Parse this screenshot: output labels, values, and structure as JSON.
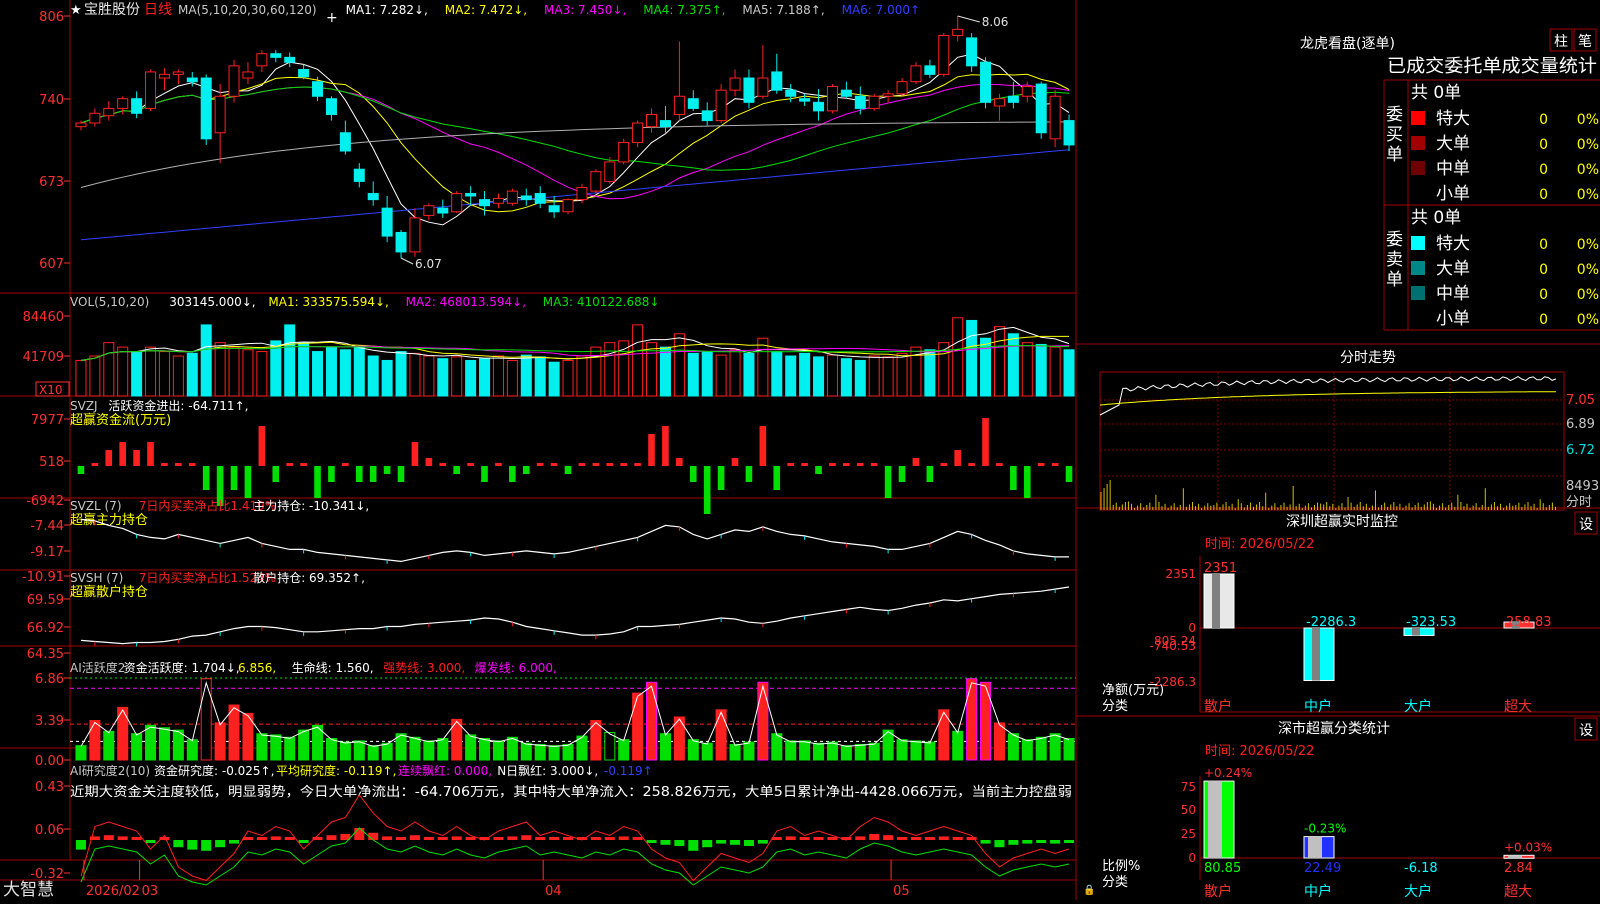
{
  "stock": {
    "star": "★",
    "name": "宝胜股份",
    "period": "日线"
  },
  "colors": {
    "up": "#ff2020",
    "down": "#00f0f0",
    "frame": "#a00000",
    "green": "#00e000",
    "yellow": "#ffff00",
    "magenta": "#ff00ff",
    "white": "#ffffff",
    "blue": "#3040ff",
    "gray": "#b0b0b0",
    "label": "#e0e0e0"
  },
  "main": {
    "header": [
      {
        "text": "MA(5,10,20,30,60,120)",
        "color": "#c8c8c8"
      },
      {
        "text": "MA1: 7.282↓,",
        "color": "#ffffff"
      },
      {
        "text": "MA2: 7.472↓,",
        "color": "#ffff00"
      },
      {
        "text": "MA3: 7.450↓,",
        "color": "#ff00ff"
      },
      {
        "text": "MA4: 7.375↑,",
        "color": "#00e000"
      },
      {
        "text": "MA5: 7.188↑,",
        "color": "#c8c8c8"
      },
      {
        "text": "MA6: 7.000↑",
        "color": "#3040ff"
      }
    ],
    "y_ticks": [
      "806",
      "740",
      "673",
      "607"
    ],
    "high_label": "8.06",
    "low_label": "6.07",
    "candles": [
      [
        7.15,
        7.2,
        7.12,
        7.18
      ],
      [
        7.18,
        7.3,
        7.15,
        7.26
      ],
      [
        7.24,
        7.36,
        7.2,
        7.3
      ],
      [
        7.3,
        7.4,
        7.25,
        7.38
      ],
      [
        7.38,
        7.44,
        7.22,
        7.26
      ],
      [
        7.3,
        7.62,
        7.28,
        7.6
      ],
      [
        7.55,
        7.63,
        7.45,
        7.58
      ],
      [
        7.58,
        7.62,
        7.5,
        7.6
      ],
      [
        7.55,
        7.6,
        7.48,
        7.52
      ],
      [
        7.55,
        7.58,
        7.0,
        7.05
      ],
      [
        7.1,
        7.5,
        6.85,
        7.4
      ],
      [
        7.4,
        7.7,
        7.35,
        7.65
      ],
      [
        7.55,
        7.68,
        7.5,
        7.6
      ],
      [
        7.65,
        7.78,
        7.6,
        7.75
      ],
      [
        7.75,
        7.78,
        7.68,
        7.72
      ],
      [
        7.72,
        7.76,
        7.64,
        7.68
      ],
      [
        7.62,
        7.66,
        7.54,
        7.56
      ],
      [
        7.52,
        7.56,
        7.36,
        7.4
      ],
      [
        7.38,
        7.4,
        7.2,
        7.25
      ],
      [
        7.1,
        7.2,
        6.92,
        6.95
      ],
      [
        6.8,
        6.85,
        6.65,
        6.7
      ],
      [
        6.6,
        6.7,
        6.5,
        6.55
      ],
      [
        6.48,
        6.58,
        6.2,
        6.25
      ],
      [
        6.28,
        6.3,
        6.07,
        6.12
      ],
      [
        6.12,
        6.48,
        6.08,
        6.4
      ],
      [
        6.42,
        6.52,
        6.38,
        6.5
      ],
      [
        6.48,
        6.55,
        6.4,
        6.44
      ],
      [
        6.45,
        6.62,
        6.44,
        6.6
      ],
      [
        6.6,
        6.66,
        6.5,
        6.58
      ],
      [
        6.55,
        6.62,
        6.42,
        6.5
      ],
      [
        6.52,
        6.6,
        6.48,
        6.56
      ],
      [
        6.52,
        6.64,
        6.5,
        6.62
      ],
      [
        6.58,
        6.64,
        6.5,
        6.55
      ],
      [
        6.6,
        6.66,
        6.48,
        6.52
      ],
      [
        6.5,
        6.58,
        6.4,
        6.45
      ],
      [
        6.45,
        6.56,
        6.43,
        6.55
      ],
      [
        6.55,
        6.68,
        6.52,
        6.65
      ],
      [
        6.62,
        6.8,
        6.6,
        6.78
      ],
      [
        6.7,
        6.9,
        6.68,
        6.86
      ],
      [
        6.86,
        7.05,
        6.84,
        7.02
      ],
      [
        7.02,
        7.2,
        6.98,
        7.18
      ],
      [
        7.15,
        7.3,
        7.1,
        7.25
      ],
      [
        7.2,
        7.32,
        7.1,
        7.15
      ],
      [
        7.25,
        7.85,
        7.2,
        7.4
      ],
      [
        7.38,
        7.45,
        7.28,
        7.3
      ],
      [
        7.28,
        7.35,
        7.16,
        7.2
      ],
      [
        7.2,
        7.5,
        7.18,
        7.45
      ],
      [
        7.45,
        7.62,
        7.4,
        7.55
      ],
      [
        7.55,
        7.62,
        7.3,
        7.35
      ],
      [
        7.4,
        7.82,
        7.38,
        7.55
      ],
      [
        7.6,
        7.75,
        7.42,
        7.45
      ],
      [
        7.45,
        7.5,
        7.35,
        7.4
      ],
      [
        7.38,
        7.42,
        7.32,
        7.36
      ],
      [
        7.35,
        7.46,
        7.2,
        7.28
      ],
      [
        7.28,
        7.5,
        7.26,
        7.48
      ],
      [
        7.45,
        7.52,
        7.38,
        7.4
      ],
      [
        7.4,
        7.48,
        7.25,
        7.3
      ],
      [
        7.3,
        7.42,
        7.28,
        7.4
      ],
      [
        7.4,
        7.45,
        7.35,
        7.42
      ],
      [
        7.42,
        7.55,
        7.4,
        7.52
      ],
      [
        7.52,
        7.68,
        7.5,
        7.65
      ],
      [
        7.65,
        7.7,
        7.55,
        7.58
      ],
      [
        7.58,
        7.92,
        7.56,
        7.9
      ],
      [
        7.9,
        8.06,
        7.85,
        7.95
      ],
      [
        7.88,
        7.92,
        7.6,
        7.65
      ],
      [
        7.68,
        7.72,
        7.3,
        7.35
      ],
      [
        7.32,
        7.42,
        7.2,
        7.38
      ],
      [
        7.4,
        7.52,
        7.3,
        7.35
      ],
      [
        7.4,
        7.52,
        7.35,
        7.48
      ],
      [
        7.5,
        7.52,
        7.05,
        7.1
      ],
      [
        7.05,
        7.45,
        6.98,
        7.4
      ],
      [
        7.2,
        7.25,
        6.95,
        7.0
      ]
    ]
  },
  "vol": {
    "header": [
      {
        "text": "VOL(5,10,20)",
        "color": "#c8c8c8"
      },
      {
        "text": "303145.000↓,",
        "color": "#ffffff"
      },
      {
        "text": "MA1: 333575.594↓,",
        "color": "#ffff00"
      },
      {
        "text": "MA2: 468013.594↓,",
        "color": "#ff00ff"
      },
      {
        "text": "MA3: 410122.688↓",
        "color": "#00e000"
      }
    ],
    "y_ticks": [
      "84460",
      "41709"
    ],
    "unit": "X10",
    "values": [
      40,
      45,
      60,
      55,
      50,
      55,
      50,
      45,
      48,
      80,
      60,
      55,
      52,
      50,
      62,
      80,
      60,
      50,
      55,
      52,
      55,
      45,
      40,
      50,
      48,
      45,
      42,
      44,
      40,
      42,
      45,
      40,
      46,
      44,
      38,
      40,
      45,
      55,
      60,
      62,
      80,
      60,
      55,
      70,
      48,
      50,
      46,
      52,
      48,
      65,
      50,
      45,
      48,
      44,
      46,
      42,
      40,
      45,
      44,
      48,
      55,
      52,
      60,
      88,
      85,
      65,
      78,
      70,
      60,
      58,
      55,
      52
    ]
  },
  "svzj": {
    "header": [
      {
        "text": "SVZJ",
        "color": "#c8c8c8"
      },
      {
        "text": "活跃资金进出: -64.711↑,",
        "color": "#ffffff"
      }
    ],
    "sub": "超赢资金流(万元)",
    "y_ticks": [
      "7977",
      "518",
      "-6942"
    ],
    "values": [
      -1,
      0,
      2,
      3,
      2,
      3,
      0,
      0,
      0,
      -3,
      -5,
      -3,
      -4,
      5,
      -2,
      0,
      0,
      -4,
      -2,
      0,
      -2,
      -2,
      -1,
      -2,
      3,
      1,
      0,
      -1,
      0,
      -2,
      0,
      -2,
      -1,
      0,
      0,
      -1,
      0,
      0,
      0,
      0,
      0,
      4,
      5,
      1,
      -2,
      -6,
      -3,
      1,
      -2,
      5,
      -3,
      0,
      0,
      -1,
      0,
      0,
      0,
      0,
      -4,
      -2,
      1,
      -2,
      0,
      2,
      0,
      6,
      0,
      -3,
      -4,
      0,
      0,
      -2
    ]
  },
  "svzl": {
    "header": [
      {
        "text": "SVZL (7)",
        "color": "#c8c8c8"
      },
      {
        "text": "7日内买卖净占比1.419%",
        "color": "#ff2020"
      },
      {
        "text": "主力持仓: -10.341↓,",
        "color": "#ffffff"
      }
    ],
    "sub": "超赢主力持仓",
    "y_ticks": [
      "-7.44",
      "-9.17",
      "-10.91"
    ],
    "values": [
      -7.8,
      -7.9,
      -8.2,
      -8.4,
      -8.8,
      -9.0,
      -9.1,
      -8.8,
      -9.0,
      -9.2,
      -9.4,
      -9.2,
      -9.0,
      -9.4,
      -9.6,
      -9.8,
      -9.8,
      -10.0,
      -10.1,
      -10.2,
      -10.3,
      -10.4,
      -10.5,
      -10.6,
      -10.4,
      -10.2,
      -10.0,
      -9.9,
      -10.0,
      -10.2,
      -10.1,
      -10.0,
      -9.9,
      -10.0,
      -10.1,
      -10.0,
      -9.8,
      -9.6,
      -9.4,
      -9.2,
      -9.0,
      -8.6,
      -8.2,
      -8.3,
      -8.8,
      -9.1,
      -8.8,
      -8.5,
      -8.6,
      -8.3,
      -8.6,
      -8.8,
      -8.9,
      -9.1,
      -9.3,
      -9.4,
      -9.5,
      -9.6,
      -9.8,
      -9.8,
      -9.6,
      -9.4,
      -9.0,
      -8.6,
      -8.8,
      -9.2,
      -9.5,
      -9.9,
      -10.1,
      -10.2,
      -10.3,
      -10.3
    ]
  },
  "svsh": {
    "header": [
      {
        "text": "SVSH (7)",
        "color": "#c8c8c8"
      },
      {
        "text": "7日内买卖净占比1.524%",
        "color": "#ff2020"
      },
      {
        "text": "散户持仓: 69.352↑,",
        "color": "#ffffff"
      }
    ],
    "sub": "超赢散户持仓",
    "y_ticks": [
      "69.59",
      "66.92",
      "64.35"
    ],
    "values": [
      64.5,
      64.4,
      64.3,
      64.2,
      64.3,
      64.3,
      64.4,
      64.6,
      64.9,
      65.0,
      65.3,
      65.6,
      65.8,
      65.8,
      65.7,
      65.5,
      65.3,
      65.3,
      65.4,
      65.5,
      65.6,
      65.6,
      65.8,
      65.8,
      66.0,
      66.1,
      66.2,
      66.3,
      66.4,
      66.6,
      66.5,
      66.2,
      65.8,
      65.6,
      65.4,
      65.2,
      65.0,
      65.0,
      65.1,
      65.3,
      65.8,
      65.8,
      65.9,
      66.0,
      66.2,
      66.4,
      66.6,
      66.5,
      66.2,
      66.1,
      66.3,
      66.6,
      66.8,
      67.0,
      67.2,
      67.4,
      67.6,
      67.4,
      67.3,
      67.5,
      67.8,
      68.0,
      68.3,
      68.2,
      68.4,
      68.6,
      68.8,
      68.9,
      69.0,
      69.1,
      69.3,
      69.5
    ]
  },
  "ai1": {
    "header": [
      {
        "text": "AI活跃度2",
        "color": "#c8c8c8"
      },
      {
        "text": "资金活跃度: 1.704↓,",
        "color": "#ffffff"
      },
      {
        "text": "6.856,",
        "color": "#ffff00"
      },
      {
        "text": "生命线: 1.560,",
        "color": "#ffffff"
      },
      {
        "text": "强势线: 3.000,",
        "color": "#ff2020"
      },
      {
        "text": "爆发线: 6.000,",
        "color": "#ff00ff"
      }
    ],
    "y_ticks": [
      "6.86",
      "3.39",
      "0.00"
    ],
    "values": [
      1.2,
      3.3,
      2.4,
      4.4,
      2.2,
      2.9,
      2.7,
      2.5,
      1.7,
      6.8,
      3.1,
      4.6,
      3.9,
      2.2,
      2.1,
      1.9,
      2.5,
      2.9,
      1.8,
      1.5,
      1.6,
      1.2,
      1.4,
      2.2,
      1.9,
      1.6,
      1.8,
      3.4,
      2.1,
      1.8,
      1.6,
      1.9,
      1.4,
      1.3,
      1.2,
      1.3,
      2.0,
      3.3,
      2.3,
      1.7,
      5.6,
      6.5,
      2.2,
      3.6,
      1.7,
      1.4,
      4.2,
      1.3,
      1.5,
      6.5,
      2.2,
      1.6,
      1.6,
      1.4,
      1.5,
      1.2,
      1.3,
      1.4,
      2.5,
      1.7,
      1.6,
      1.5,
      4.2,
      2.4,
      6.8,
      6.5,
      3.1,
      2.2,
      1.7,
      1.9,
      2.2,
      1.8
    ]
  },
  "ai2": {
    "header": [
      {
        "text": "AI研究度2(10)",
        "color": "#c8c8c8"
      },
      {
        "text": "资金研究度: -0.025↑,",
        "color": "#ffffff"
      },
      {
        "text": "平均研究度: -0.119↑,",
        "color": "#ffff00"
      },
      {
        "text": "连续飘红: 0.000,",
        "color": "#ff00ff"
      },
      {
        "text": "N日飘红: 3.000↓,",
        "color": "#ffffff"
      },
      {
        "text": "-0.119↑",
        "color": "#3040ff"
      }
    ],
    "note": "近期大资金关注度较低，明显弱势，今日大单净流出：-64.706万元，其中特大单净流入：258.826万元，大单5日累计净出-4428.066万元，当前主力控盘弱",
    "y_ticks": [
      "0.43",
      "0.06",
      "-0.32"
    ],
    "values": [
      -0.08,
      0.03,
      0.04,
      0.03,
      0.02,
      -0.02,
      0.01,
      -0.06,
      -0.08,
      -0.09,
      -0.06,
      -0.03,
      0.02,
      0.01,
      0.03,
      0.02,
      -0.02,
      0.01,
      0.04,
      0.05,
      0.1,
      0.06,
      0.03,
      0.02,
      0.04,
      0.02,
      0.01,
      0.03,
      0.01,
      0.0,
      0.02,
      0.03,
      0.04,
      0.01,
      0.02,
      0.01,
      0.0,
      0.02,
      0.01,
      0.03,
      0.02,
      -0.02,
      -0.04,
      -0.05,
      -0.09,
      -0.06,
      -0.03,
      -0.04,
      -0.05,
      -0.03,
      0.02,
      0.03,
      0.01,
      0.02,
      0.01,
      0.0,
      0.03,
      0.05,
      0.04,
      0.02,
      0.01,
      0.02,
      0.03,
      0.02,
      0.01,
      -0.03,
      -0.06,
      -0.04,
      -0.03,
      -0.02,
      -0.03,
      -0.02
    ]
  },
  "x_labels": [
    {
      "text": "2026/02",
      "i": 0.5
    },
    {
      "text": "03",
      "i": 4.5
    },
    {
      "text": "04",
      "i": 33.5
    },
    {
      "text": "05",
      "i": 58.5
    }
  ],
  "brand": "大智慧",
  "right": {
    "lhp_title": "龙虎看盘(逐单)",
    "btn1": "柱",
    "btn2": "笔",
    "stats_title": "已成交委托单成交量统计",
    "buy_side": "委买单",
    "sell_side": "委卖单",
    "buy_total": "共 0单",
    "sell_total": "共 0单",
    "buy_rows": [
      {
        "label": "特大",
        "val": "0",
        "pct": "0%",
        "color": "#ff0000"
      },
      {
        "label": "大单",
        "val": "0",
        "pct": "0%",
        "color": "#a00000"
      },
      {
        "label": "中单",
        "val": "0",
        "pct": "0%",
        "color": "#700000"
      },
      {
        "label": "小单",
        "val": "0",
        "pct": "0%",
        "color": ""
      }
    ],
    "sell_rows": [
      {
        "label": "特大",
        "val": "0",
        "pct": "0%",
        "color": "#00ffff"
      },
      {
        "label": "大单",
        "val": "0",
        "pct": "0%",
        "color": "#008888"
      },
      {
        "label": "中单",
        "val": "0",
        "pct": "0%",
        "color": "#007070"
      },
      {
        "label": "小单",
        "val": "0",
        "pct": "0%",
        "color": ""
      }
    ],
    "intraday_title": "分时走势",
    "intraday_ticks": [
      "7.05",
      "6.89",
      "6.72"
    ],
    "intraday_vol": "8493",
    "intraday_foot": "分时",
    "sz_title": "深圳超赢实时监控",
    "set": "设",
    "time": "时间: 2026/05/22",
    "sz_ticks": [
      "2351",
      "805.24",
      "0",
      "-740.53",
      "-2286.3"
    ],
    "sz_axis_label": "净额(万元)",
    "sz_axis_label2": "分类",
    "sz_bars": [
      {
        "val": 2351,
        "label": "2351",
        "color": "#e8e8e8"
      },
      {
        "val": -2286.3,
        "label": "-2286.3",
        "color": "#00ffff"
      },
      {
        "val": -323.53,
        "label": "-323.53",
        "color": "#00ffff"
      },
      {
        "val": 258.83,
        "label": "258.83",
        "color": "#ff3030"
      }
    ],
    "categories": [
      "散户",
      "中户",
      "大户",
      "超大"
    ],
    "ss_title": "深市超赢分类统计",
    "ss_ticks": [
      "75",
      "50",
      "25",
      "0"
    ],
    "ss_axis_label": "比例%",
    "ss_axis_label2": "分类",
    "ss_bars": [
      {
        "val": 80.85,
        "label": "80.85",
        "top": "+0.24%",
        "top_color": "#ff3030",
        "color": "#00ff00"
      },
      {
        "val": 22.49,
        "label": "22.49",
        "top": "-0.23%",
        "top_color": "#00ff00",
        "color": "#2030ff"
      },
      {
        "val": -6.18,
        "label": "-6.18",
        "top": "",
        "top_color": "#00ffff",
        "color": "#00ffff"
      },
      {
        "val": 2.84,
        "label": "2.84",
        "top": "+0.03%",
        "top_color": "#ff3030",
        "color": "#ff3030"
      }
    ]
  }
}
